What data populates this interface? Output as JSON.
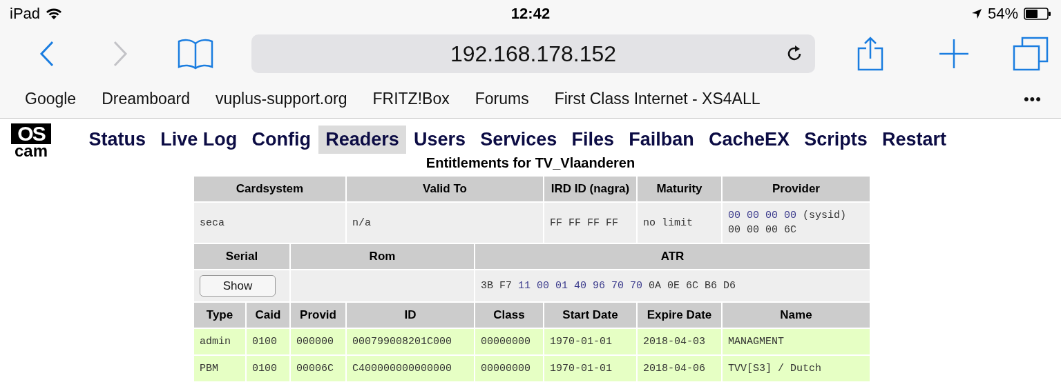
{
  "status_bar": {
    "device": "iPad",
    "time": "12:42",
    "battery": "54%"
  },
  "browser": {
    "address": "192.168.178.152",
    "bookmarks": [
      "Google",
      "Dreamboard",
      "vuplus-support.org",
      "FRITZ!Box",
      "Forums",
      "First Class Internet - XS4ALL"
    ],
    "more": "•••"
  },
  "logo": {
    "top": "OS",
    "bottom": "cam"
  },
  "nav": [
    {
      "label": "Status",
      "selected": false
    },
    {
      "label": "Live Log",
      "selected": false
    },
    {
      "label": "Config",
      "selected": false
    },
    {
      "label": "Readers",
      "selected": true
    },
    {
      "label": "Users",
      "selected": false
    },
    {
      "label": "Services",
      "selected": false
    },
    {
      "label": "Files",
      "selected": false
    },
    {
      "label": "Failban",
      "selected": false
    },
    {
      "label": "CacheEX",
      "selected": false
    },
    {
      "label": "Scripts",
      "selected": false
    },
    {
      "label": "Restart",
      "selected": false
    }
  ],
  "title": "Entitlements for TV_Vlaanderen",
  "card": {
    "headers": [
      "Cardsystem",
      "Valid To",
      "IRD ID (nagra)",
      "Maturity",
      "Provider"
    ],
    "cardsystem": "seca",
    "valid_to": "n/a",
    "ird_id": "FF FF FF FF",
    "maturity": "no limit",
    "provider_lines": [
      [
        {
          "text": "00 00 00 00",
          "kind": "highlight"
        },
        {
          "text": "(sysid)",
          "kind": "plain"
        }
      ],
      [
        {
          "text": "00 00 00 6C",
          "kind": "plain"
        }
      ]
    ]
  },
  "reader": {
    "headers": [
      "Serial",
      "Rom",
      "ATR"
    ],
    "serial_button": "Show",
    "atr": [
      {
        "text": "3B F7",
        "kind": "plain"
      },
      {
        "text": "11 00 01 40 96 70 70",
        "kind": "highlight"
      },
      {
        "text": "0A 0E 6C B6 D6",
        "kind": "plain"
      }
    ]
  },
  "entitlements": {
    "columns": [
      "Type",
      "Caid",
      "Provid",
      "ID",
      "Class",
      "Start Date",
      "Expire Date",
      "Name"
    ],
    "rows": [
      [
        "admin",
        "0100",
        "000000",
        "000799008201C000",
        "00000000",
        "1970-01-01",
        "2018-04-03",
        "MANAGMENT"
      ],
      [
        "PBM",
        "0100",
        "00006C",
        "C400000000000000",
        "00000000",
        "1970-01-01",
        "2018-04-06",
        "TVV[S3] / Dutch"
      ]
    ]
  }
}
